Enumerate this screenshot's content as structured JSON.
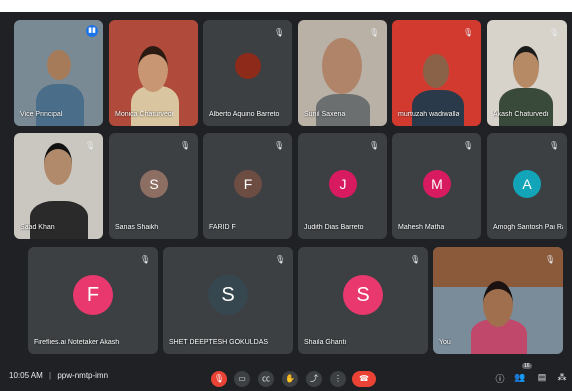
{
  "tiles": [
    {
      "name": "Vice Principal",
      "type": "video",
      "speaking": true
    },
    {
      "name": "Monica Chaturvedi",
      "type": "video"
    },
    {
      "name": "Alberto Aquino Barreto",
      "type": "video",
      "muted": true
    },
    {
      "name": "Sunil Saxena",
      "type": "video",
      "muted": true
    },
    {
      "name": "murtuzah wadiwalla",
      "type": "video",
      "muted": true
    },
    {
      "name": "Akash Chaturvedi",
      "type": "video",
      "muted": true
    },
    {
      "name": "Saad Khan",
      "type": "video",
      "muted": true
    },
    {
      "name": "Sanas Shaikh",
      "initial": "S",
      "color": "#8d6e63",
      "muted": true
    },
    {
      "name": "FARID F",
      "initial": "F",
      "color": "#6d4c41",
      "muted": true
    },
    {
      "name": "Judith Dias Barreto",
      "initial": "J",
      "color": "#d81b60",
      "muted": true
    },
    {
      "name": "Mahesh Matha",
      "initial": "M",
      "color": "#d81b60",
      "muted": true
    },
    {
      "name": "Amogh Santosh Pai Rai...",
      "initial": "A",
      "color": "#12a4b8",
      "muted": true
    },
    {
      "name": "Fireflies.ai Notetaker Akash",
      "initial": "F",
      "color": "#e8386e",
      "muted": true
    },
    {
      "name": "SHET DEEPTESH GOKULDAS",
      "initial": "S",
      "color": "#37474f",
      "muted": true
    },
    {
      "name": "Shaila Ghanti",
      "initial": "S",
      "color": "#e8386e",
      "muted": true
    },
    {
      "name": "You",
      "type": "video",
      "muted": true
    }
  ],
  "bottom_bar": {
    "time": "10:05 AM",
    "separator": "|",
    "meeting_code": "ppw-nmtp-imn",
    "participant_count": "16",
    "icons": [
      "mic-off-icon",
      "camera-icon",
      "captions-icon",
      "raise-hand-icon",
      "present-icon",
      "more-icon",
      "end-call-icon",
      "info-icon",
      "people-icon",
      "chat-icon",
      "activities-icon"
    ]
  },
  "icons": {
    "muted": "mic-off-icon",
    "speaking": "audio-level-icon"
  },
  "colors": {
    "end_call": "#ea4335",
    "speaking": "#1a73e8",
    "tile_bg": "#3c4043",
    "page_bg": "#202124"
  }
}
